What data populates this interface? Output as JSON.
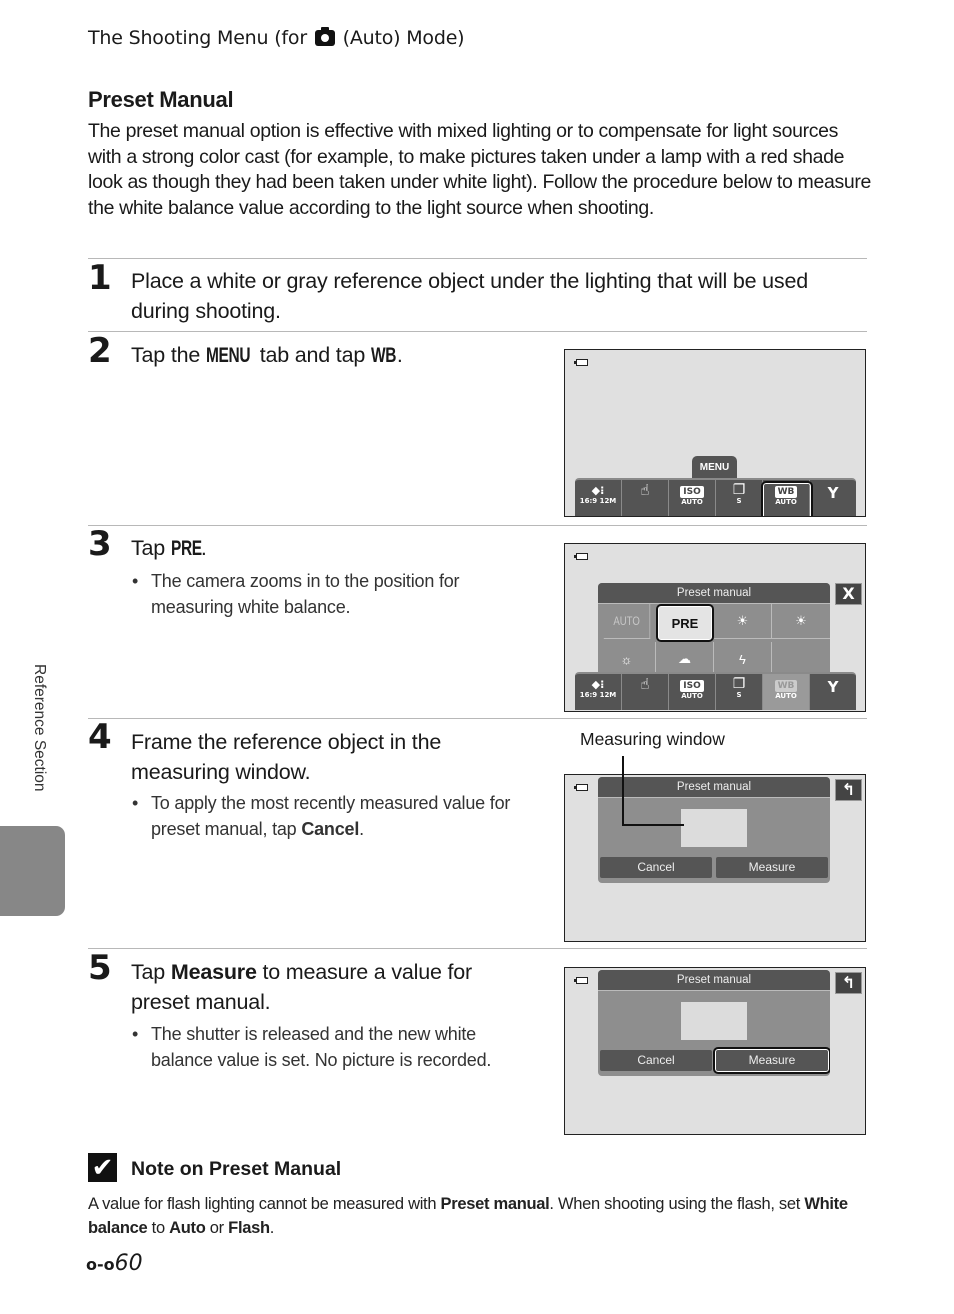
{
  "running_head": {
    "before": "The Shooting Menu (for",
    "icon": "camera-auto-icon",
    "after": "(Auto) Mode)"
  },
  "section": {
    "title": "Preset Manual",
    "intro": "The preset manual option is effective with mixed lighting or to compensate for light sources with a strong color cast (for example, to make pictures taken under a lamp with a red shade look as though they had been taken under white light). Follow the procedure below to measure the white balance value according to the light source when shooting."
  },
  "steps": [
    {
      "num": "1",
      "text": "Place a white or gray reference object under the lighting that will be used during shooting."
    },
    {
      "num": "2",
      "text_a": "Tap the",
      "menu_glyph": "MENU",
      "text_b": "tab and tap",
      "wb_glyph": "WB",
      "text_c": "."
    },
    {
      "num": "3",
      "text_a": "Tap",
      "pre_glyph": "PRE",
      "text_c": ".",
      "bullet": "The camera zooms in to the position for measuring white balance."
    },
    {
      "num": "4",
      "text": "Frame the reference object in the measuring window.",
      "bullet_a": "To apply the most recently measured value for preset manual, tap",
      "bullet_bold": "Cancel",
      "bullet_c": "."
    },
    {
      "num": "5",
      "text_a": "Tap",
      "text_bold": "Measure",
      "text_b": "to measure a value for preset manual.",
      "bullet": "The shutter is released and the new white balance value is set. No picture is recorded."
    }
  ],
  "screens": {
    "menu_tab": "MENU",
    "menubar": [
      {
        "icon": "image-mode-icon",
        "glyph": "◆⁝",
        "bottom": "16:9 12M"
      },
      {
        "icon": "touch-shooting-icon",
        "glyph": "☝",
        "bottom": ""
      },
      {
        "icon": "iso-icon",
        "glyph": "ISO",
        "bottom": "AUTO"
      },
      {
        "icon": "continuous-icon",
        "glyph": "❐",
        "bottom": "S"
      },
      {
        "icon": "white-balance-icon",
        "glyph": "WB",
        "bottom": "AUTO"
      },
      {
        "icon": "setup-wrench-icon",
        "glyph": "Y",
        "bottom": ""
      }
    ],
    "preset_title": "Preset manual",
    "wb_options": [
      {
        "label": "AUTO",
        "icon": "auto-wb-icon"
      },
      {
        "label": "PRE",
        "icon": "preset-manual-icon"
      },
      {
        "label": "☀",
        "icon": "daylight-icon"
      },
      {
        "label": "☀",
        "icon": "incandescent-icon"
      },
      {
        "label": "☼",
        "icon": "fluorescent-icon"
      },
      {
        "label": "☁",
        "icon": "cloudy-icon"
      },
      {
        "label": "ϟ",
        "icon": "flash-icon"
      },
      {
        "label": "",
        "icon": ""
      }
    ],
    "close_glyph": "X",
    "back_glyph": "↰",
    "cancel_label": "Cancel",
    "measure_label": "Measure",
    "callout": "Measuring window"
  },
  "side_label": "Reference Section",
  "note": {
    "title": "Note on Preset Manual",
    "t1": "A value for flash lighting cannot be measured with",
    "b1": "Preset manual",
    "t2": ". When shooting using the flash, set",
    "b2": "White balance",
    "t3": "to",
    "b3": "Auto",
    "t4": "or",
    "b4": "Flash",
    "t5": "."
  },
  "page_number": "60"
}
